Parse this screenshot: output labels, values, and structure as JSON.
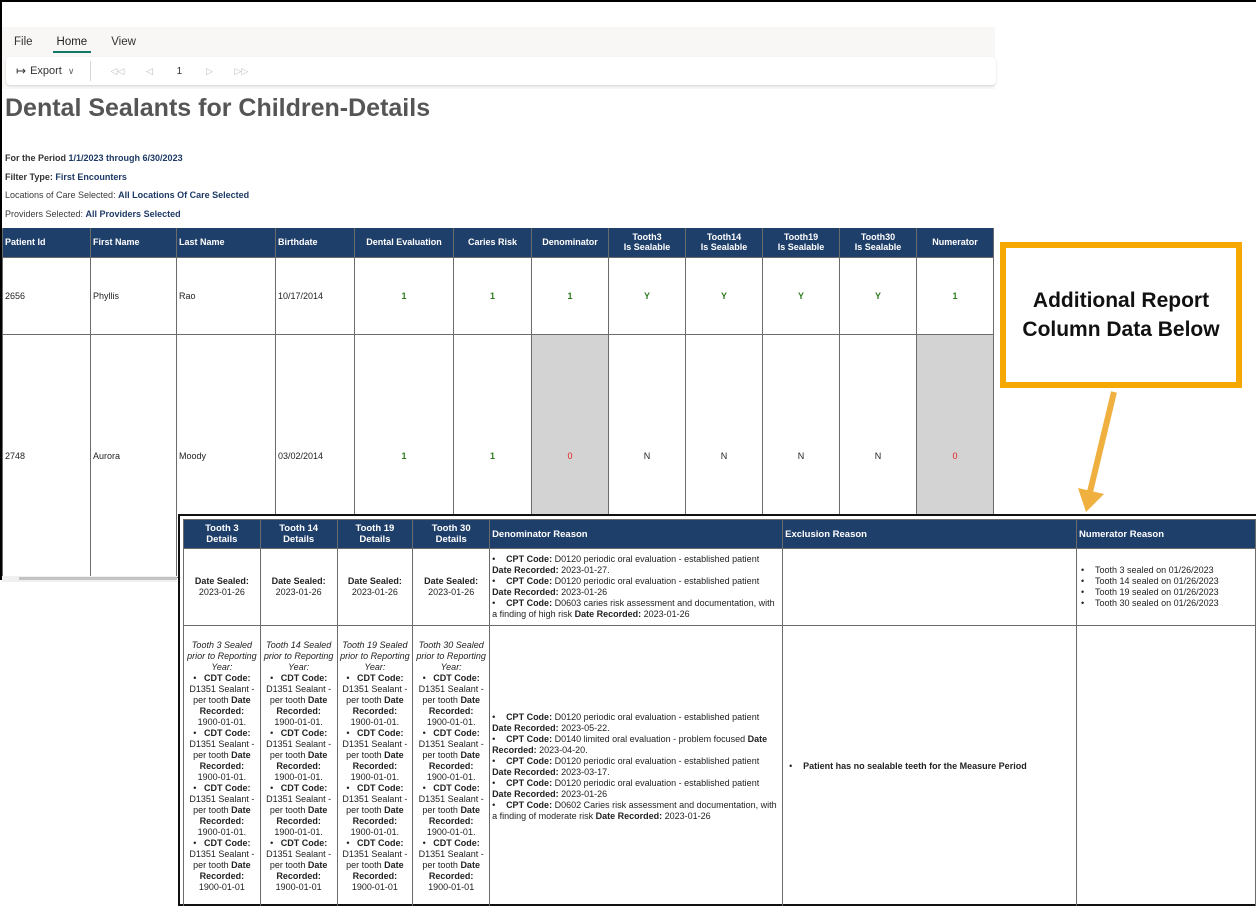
{
  "ribbon": {
    "menu_tabs": [
      {
        "label": "File",
        "active": false
      },
      {
        "label": "Home",
        "active": true
      },
      {
        "label": "View",
        "active": false
      }
    ],
    "export_icon": "export-arrow-icon",
    "export_label": "Export",
    "pager": {
      "first_icon": "first-page-icon",
      "prev_icon": "previous-page-icon",
      "current_page": "1",
      "next_icon": "next-page-icon",
      "last_icon": "last-page-icon"
    }
  },
  "report": {
    "title": "Dental Sealants for Children-Details",
    "params": [
      {
        "label": "For the Period ",
        "value": "1/1/2023 through 6/30/2023"
      },
      {
        "label": "Filter Type: ",
        "value": "First Encounters"
      },
      {
        "label": "Locations of Care Selected: ",
        "value": "All Locations Of Care Selected"
      },
      {
        "label": "Providers Selected: ",
        "value": "All Providers Selected"
      }
    ]
  },
  "main_table": {
    "headers": [
      "Patient Id",
      "First Name",
      "Last Name",
      "Birthdate",
      "Dental Evaluation",
      "Caries Risk",
      "Denominator",
      "Tooth3\nIs Sealable",
      "Tooth14\nIs Sealable",
      "Tooth19\nIs Sealable",
      "Tooth30\nIs Sealable",
      "Numerator"
    ],
    "header_lines": [
      [
        "Patient Id"
      ],
      [
        "First Name"
      ],
      [
        "Last Name"
      ],
      [
        "Birthdate"
      ],
      [
        "Dental Evaluation"
      ],
      [
        "Caries Risk"
      ],
      [
        "Denominator"
      ],
      [
        "Tooth3",
        "Is Sealable"
      ],
      [
        "Tooth14",
        "Is Sealable"
      ],
      [
        "Tooth19",
        "Is Sealable"
      ],
      [
        "Tooth30",
        "Is Sealable"
      ],
      [
        "Numerator"
      ]
    ],
    "rows": [
      {
        "patient_id": "2656",
        "first_name": "Phyllis",
        "last_name": "Rao",
        "birthdate": "10/17/2014",
        "dental_evaluation": "1",
        "caries_risk": "1",
        "denominator": "1",
        "tooth3": "Y",
        "tooth14": "Y",
        "tooth19": "Y",
        "tooth30": "Y",
        "numerator": "1"
      },
      {
        "patient_id": "2748",
        "first_name": "Aurora",
        "last_name": "Moody",
        "birthdate": "03/02/2014",
        "dental_evaluation": "1",
        "caries_risk": "1",
        "denominator": "0",
        "tooth3": "N",
        "tooth14": "N",
        "tooth19": "N",
        "tooth30": "N",
        "numerator": "0"
      }
    ]
  },
  "callout": {
    "line1": "Additional Report",
    "line2": "Column Data Below"
  },
  "detail_table": {
    "header_lines": [
      [
        "Tooth 3",
        "Details"
      ],
      [
        "Tooth 14",
        "Details"
      ],
      [
        "Tooth 19",
        "Details"
      ],
      [
        "Tooth 30",
        "Details"
      ],
      [
        "Denominator Reason"
      ],
      [
        "Exclusion Reason"
      ],
      [
        "Numerator Reason"
      ]
    ],
    "rows": [
      {
        "teeth": [
          {
            "label": "Date Sealed:",
            "date": "2023-01-26"
          },
          {
            "label": "Date Sealed:",
            "date": "2023-01-26"
          },
          {
            "label": "Date Sealed:",
            "date": "2023-01-26"
          },
          {
            "label": "Date Sealed:",
            "date": "2023-01-26"
          }
        ],
        "denominator_reason": [
          {
            "code_label": "CPT Code:",
            "code": " D0120 periodic oral evaluation - established patient ",
            "date_label": "Date Recorded:",
            "date": " 2023-01-27."
          },
          {
            "code_label": "CPT Code:",
            "code": " D0120 periodic oral evaluation - established patient ",
            "date_label": "Date Recorded:",
            "date": " 2023-01-26"
          },
          {
            "code_label": "CPT Code:",
            "code": " D0603 caries risk assessment and documentation, with a finding of high risk ",
            "date_label": "Date Recorded:",
            "date": " 2023-01-26"
          }
        ],
        "exclusion_reason": "",
        "numerator_reason": [
          "Tooth 3 sealed on 01/26/2023",
          "Tooth 14 sealed on 01/26/2023",
          "Tooth 19 sealed on 01/26/2023",
          "Tooth 30 sealed on 01/26/2023"
        ]
      },
      {
        "teeth": [
          {
            "prior": "Tooth 3 Sealed prior to Reporting Year:",
            "entries": [
              "1900-01-01.",
              "1900-01-01.",
              "1900-01-01.",
              "1900-01-01"
            ]
          },
          {
            "prior": "Tooth 14 Sealed prior to Reporting Year:",
            "entries": [
              "1900-01-01.",
              "1900-01-01.",
              "1900-01-01.",
              "1900-01-01"
            ]
          },
          {
            "prior": "Tooth 19 Sealed prior to Reporting Year:",
            "entries": [
              "1900-01-01.",
              "1900-01-01.",
              "1900-01-01.",
              "1900-01-01"
            ]
          },
          {
            "prior": "Tooth 30 Sealed prior to Reporting Year:",
            "entries": [
              "1900-01-01.",
              "1900-01-01.",
              "1900-01-01.",
              "1900-01-01"
            ]
          }
        ],
        "cdt_label": "CDT Code:",
        "cdt_code": " D1351 Sealant - per tooth ",
        "date_label": "Date Recorded:",
        "denominator_reason": [
          {
            "code_label": "CPT Code:",
            "code": " D0120 periodic oral evaluation - established patient ",
            "date_label": "Date Recorded:",
            "date": " 2023-05-22."
          },
          {
            "code_label": "CPT Code:",
            "code": " D0140 limited oral evaluation - problem focused ",
            "date_label": "Date Recorded:",
            "date": " 2023-04-20."
          },
          {
            "code_label": "CPT Code:",
            "code": " D0120 periodic oral evaluation - established patient ",
            "date_label": "Date Recorded:",
            "date": " 2023-03-17."
          },
          {
            "code_label": "CPT Code:",
            "code": " D0120 periodic oral evaluation - established patient ",
            "date_label": "Date Recorded:",
            "date": " 2023-01-26"
          },
          {
            "code_label": "CPT Code:",
            "code": " D0602 Caries risk assessment and documentation, with a finding of moderate risk ",
            "date_label": "Date Recorded:",
            "date": " 2023-01-26"
          }
        ],
        "exclusion_reason": "Patient has no sealable teeth for the Measure Period",
        "numerator_reason": []
      }
    ]
  },
  "colors": {
    "header_bg": "#1f3f6b",
    "positive_value": "#2e7d1e",
    "negative_value": "#e62020",
    "excluded_cell_bg": "#d3d3d3",
    "callout_border": "#f5a800",
    "active_tab_underline": "#117865"
  }
}
